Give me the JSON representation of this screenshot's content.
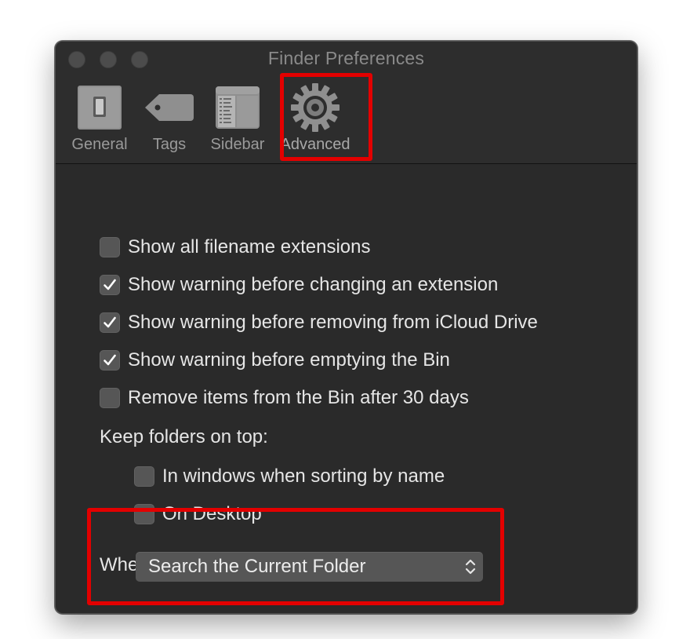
{
  "window": {
    "title": "Finder Preferences"
  },
  "toolbar": {
    "tabs": [
      {
        "label": "General",
        "icon": "switch-icon"
      },
      {
        "label": "Tags",
        "icon": "tag-icon"
      },
      {
        "label": "Sidebar",
        "icon": "sidebar-icon"
      },
      {
        "label": "Advanced",
        "icon": "gear-icon",
        "selected": true
      }
    ]
  },
  "options": [
    {
      "label": "Show all filename extensions",
      "checked": false
    },
    {
      "label": "Show warning before changing an extension",
      "checked": true
    },
    {
      "label": "Show warning before removing from iCloud Drive",
      "checked": true
    },
    {
      "label": "Show warning before emptying the Bin",
      "checked": true
    },
    {
      "label": "Remove items from the Bin after 30 days",
      "checked": false
    }
  ],
  "keep_folders": {
    "heading": "Keep folders on top:",
    "options": [
      {
        "label": "In windows when sorting by name",
        "checked": false
      },
      {
        "label": "On Desktop",
        "checked": false
      }
    ]
  },
  "search": {
    "heading": "When performing a search:",
    "selected": "Search the Current Folder"
  },
  "colors": {
    "window_bg": "#2a2a2a",
    "highlight": "#e30000",
    "text": "#e6e6e6",
    "checkbox_bg": "#565656"
  }
}
